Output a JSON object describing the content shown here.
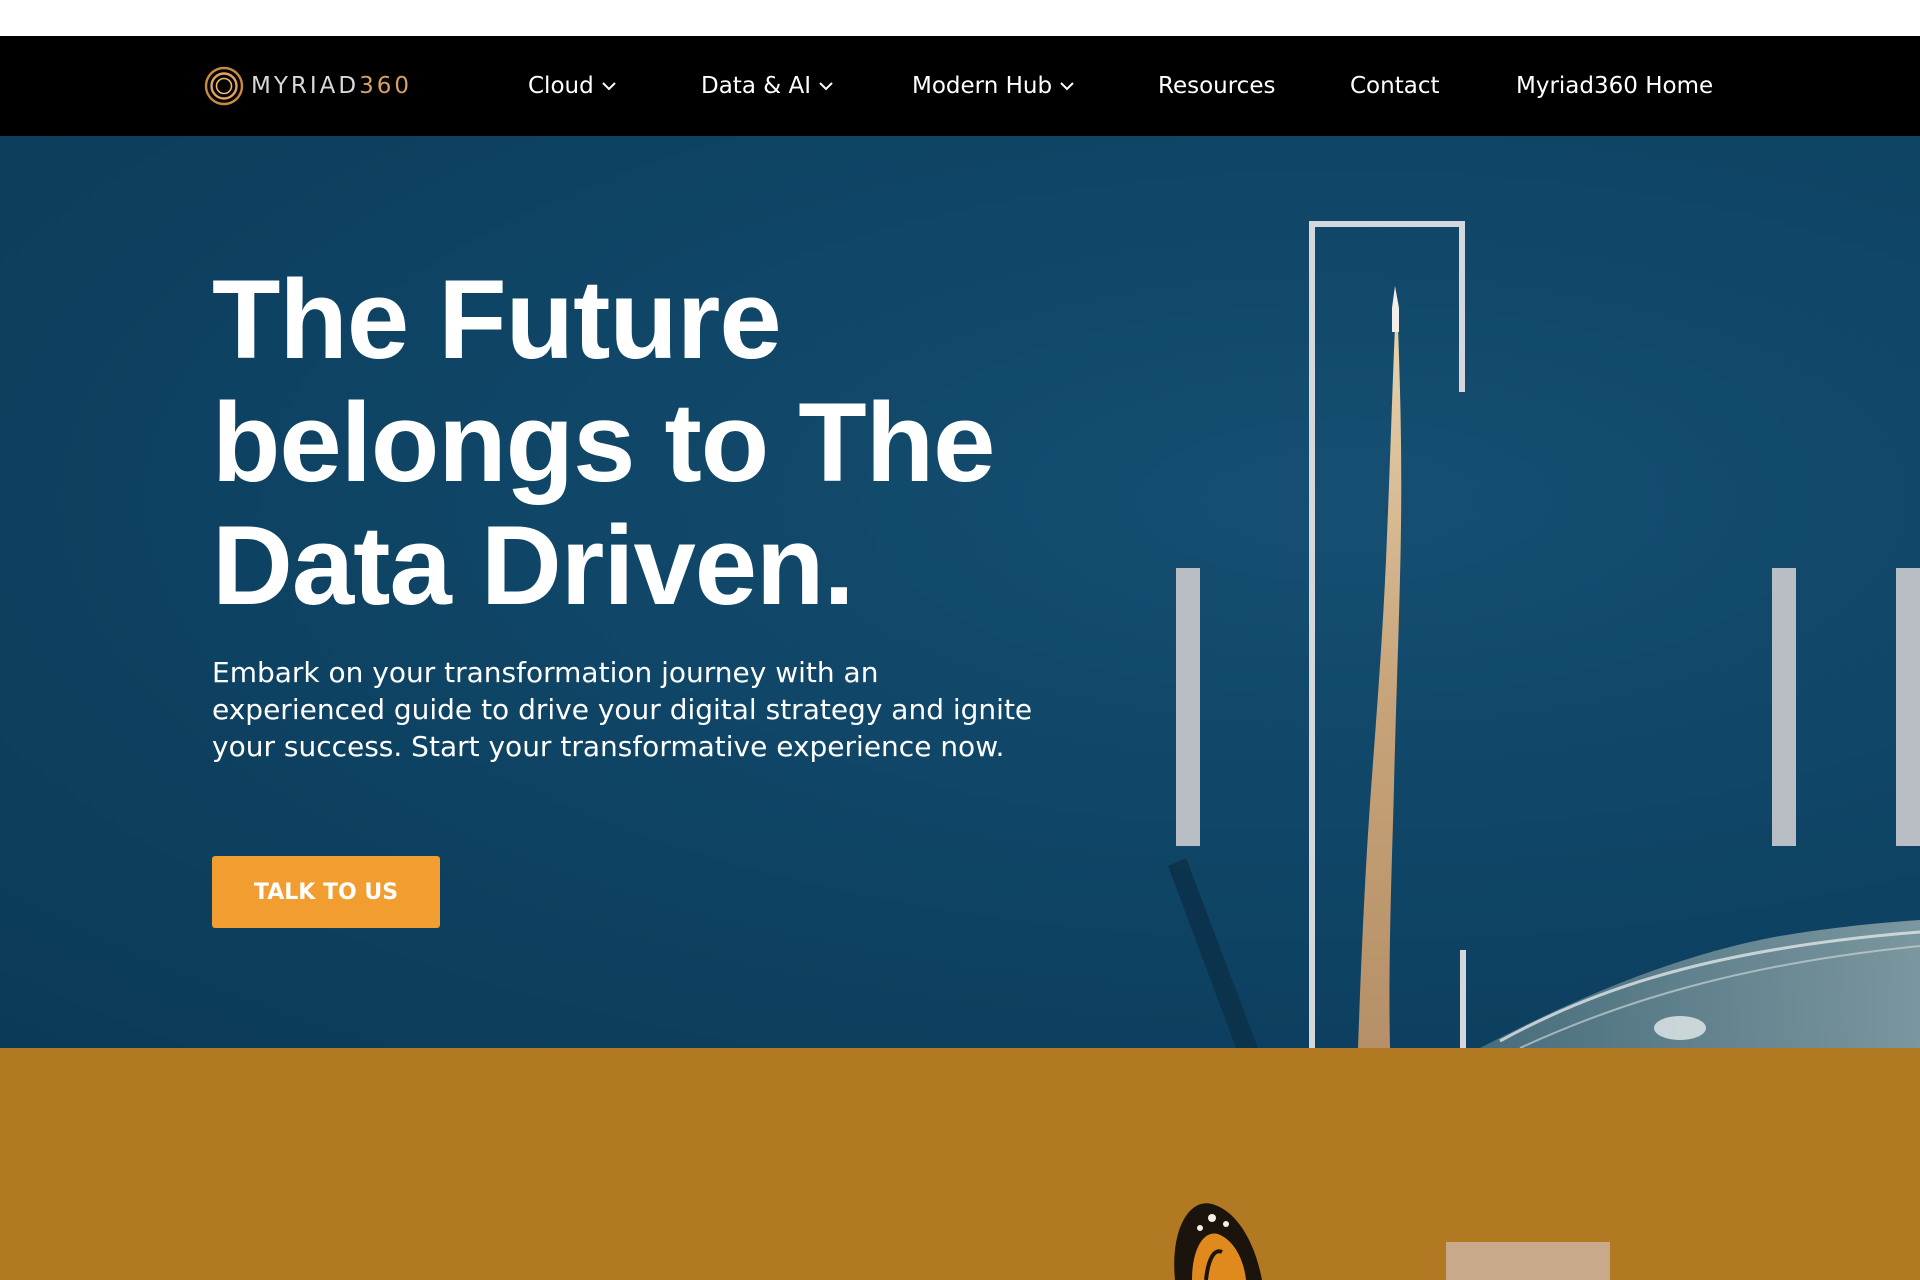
{
  "brand": {
    "logo_text_main": "MYRIAD",
    "logo_text_num": "360",
    "logo_icon": "myriad360-ring-logo-icon"
  },
  "nav": {
    "items": [
      {
        "label": "Cloud",
        "has_dropdown": true
      },
      {
        "label": "Data & AI",
        "has_dropdown": true
      },
      {
        "label": "Modern Hub",
        "has_dropdown": true
      },
      {
        "label": "Resources",
        "has_dropdown": false
      },
      {
        "label": "Contact",
        "has_dropdown": false
      },
      {
        "label": "Myriad360 Home",
        "has_dropdown": false
      }
    ]
  },
  "hero": {
    "title_lines": [
      "The Future",
      "belongs to The",
      "Data Driven."
    ],
    "subtitle_lines": [
      "Embark on your transformation journey with an",
      "experienced guide to drive your digital strategy and ignite",
      "your success. Start your transformative experience now."
    ],
    "cta_label": "TALK TO US",
    "background_image": "rocket-launch-aerial-photo"
  },
  "colors": {
    "nav_bg": "#000000",
    "hero_bg": "#0f4566",
    "cta_bg": "#f29d2f",
    "section2_bg": "#b17921",
    "logo_accent": "#d8a060"
  },
  "section2": {
    "image": "butterfly-photo"
  }
}
